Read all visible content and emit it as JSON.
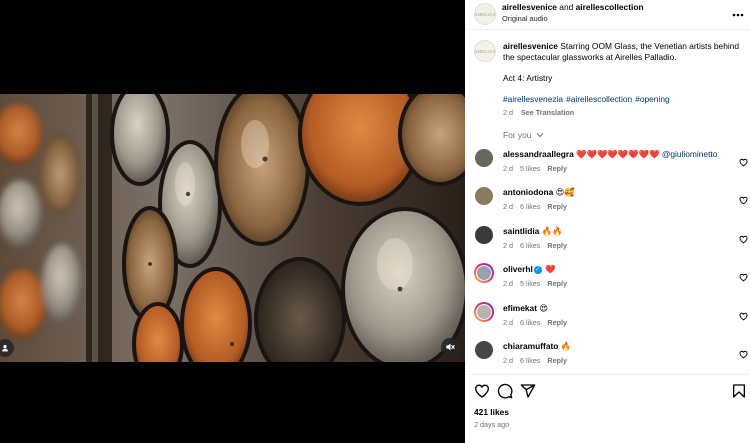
{
  "post": {
    "header": {
      "author": "airellesvenice",
      "connector": "and",
      "coauthor": "airellescollection",
      "audio": "Original audio",
      "brand_mark": "AIRELLES"
    },
    "caption": {
      "author": "airellesvenice",
      "text": "Starring OOM Glass, the Venetian artists behind the spectacular glassworks at Airelles Palladio.",
      "act": "Act 4: Artistry",
      "hashtags": [
        "#airellesvenezia",
        "#airellescollection",
        "#opening"
      ],
      "age": "2 d",
      "see_translation": "See Translation"
    },
    "for_you": "For you",
    "comments": [
      {
        "user": "alessandraallegra",
        "text": "❤️❤️❤️❤️❤️❤️❤️❤️",
        "mention": "@giuliominetto",
        "age": "2 d",
        "likes": "5 likes",
        "reply": "Reply",
        "story_ring": false,
        "verified": false,
        "avatar_color": "#6a665c"
      },
      {
        "user": "antoniodona",
        "text": "😍🥰",
        "mention": "",
        "age": "2 d",
        "likes": "6 likes",
        "reply": "Reply",
        "story_ring": false,
        "verified": false,
        "avatar_color": "#8a7a5e"
      },
      {
        "user": "saintlidia",
        "text": "🔥🔥",
        "mention": "",
        "age": "2 d",
        "likes": "6 likes",
        "reply": "Reply",
        "story_ring": false,
        "verified": false,
        "avatar_color": "#3a3a3a"
      },
      {
        "user": "oliverhl",
        "text": "❤️",
        "mention": "",
        "age": "2 d",
        "likes": "5 likes",
        "reply": "Reply",
        "story_ring": true,
        "verified": true,
        "avatar_color": "#9aa3ad"
      },
      {
        "user": "efimekat",
        "text": "😍",
        "mention": "",
        "age": "2 d",
        "likes": "6 likes",
        "reply": "Reply",
        "story_ring": true,
        "verified": false,
        "avatar_color": "#b7b4ae"
      },
      {
        "user": "chiaramuffato",
        "text": "🔥",
        "mention": "",
        "age": "2 d",
        "likes": "6 likes",
        "reply": "Reply",
        "story_ring": false,
        "verified": false,
        "avatar_color": "#4a4440"
      }
    ],
    "likes_count": "421 likes",
    "posted": "2 days ago"
  },
  "icons": {
    "more": "more-horizontal-icon",
    "like": "heart-outline-icon",
    "comment": "speech-bubble-icon",
    "share": "paper-plane-icon",
    "save": "bookmark-icon",
    "mute": "muted-speaker-icon",
    "tag": "user-tag-icon"
  },
  "colors": {
    "link": "#00376b",
    "secondary_text": "#737373",
    "verified": "#0095f6"
  }
}
